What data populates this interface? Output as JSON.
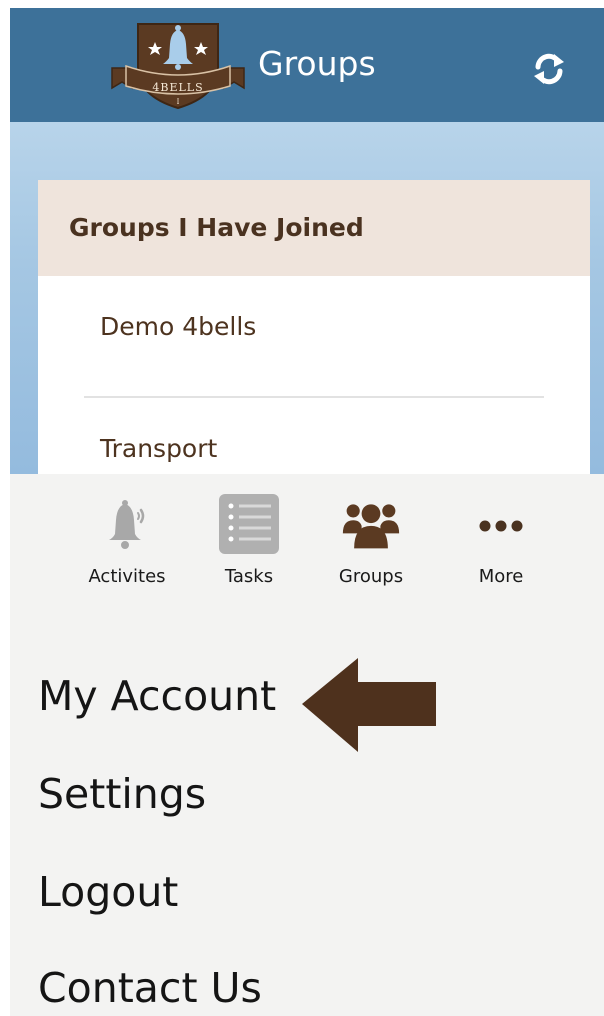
{
  "app": {
    "logo_text": "4BELLS",
    "title": "Groups",
    "accent_color": "#3d7199",
    "brand_brown": "#4a3220"
  },
  "groups": {
    "section_title": "Groups I Have Joined",
    "items": [
      {
        "label": "Demo 4bells"
      },
      {
        "label": "Transport"
      }
    ]
  },
  "tabs": [
    {
      "label": "Activites",
      "icon": "bell-icon",
      "active": false
    },
    {
      "label": "Tasks",
      "icon": "list-icon",
      "active": false
    },
    {
      "label": "Groups",
      "icon": "people-icon",
      "active": true
    },
    {
      "label": "More",
      "icon": "more-dots-icon",
      "active": false
    }
  ],
  "menu": {
    "items": [
      {
        "label": "My Account"
      },
      {
        "label": "Settings"
      },
      {
        "label": "Logout"
      },
      {
        "label": "Contact Us"
      }
    ]
  }
}
